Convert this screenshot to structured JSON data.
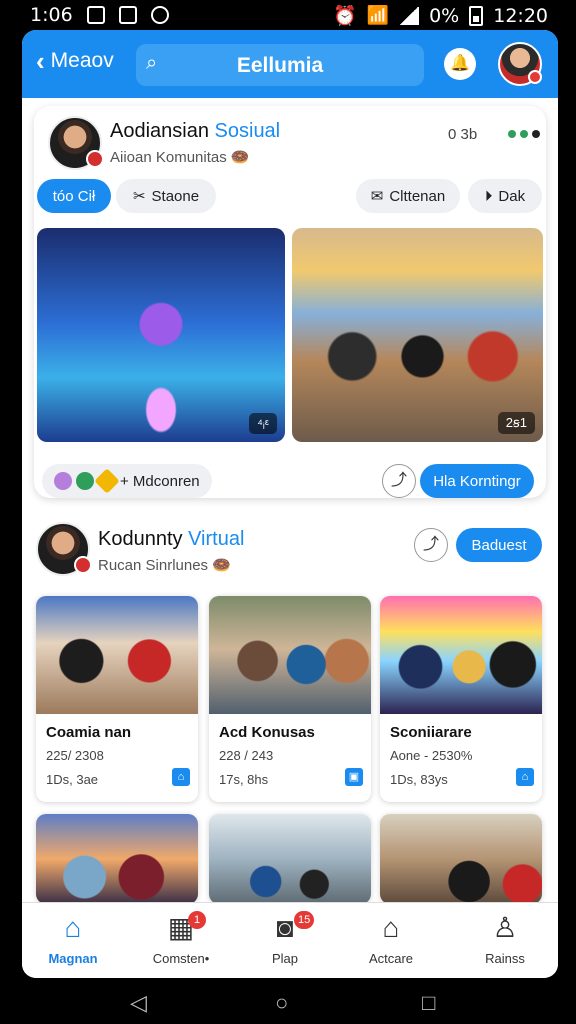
{
  "status_bar": {
    "time_left": "1:06",
    "battery": "0%",
    "time_right": "12:20"
  },
  "header": {
    "back_label": "Meaov",
    "search_title": "Eellumia"
  },
  "post1": {
    "name": "Aodiansian",
    "name_accent": "Sosiual",
    "subtitle": "Aiioan Komunitas",
    "time": "0 3b",
    "chips": [
      "tóo Cił",
      "Staone",
      "Clttenan",
      "Dak"
    ],
    "photo_tags": [
      "⁴ᵢᵋ",
      "2ꞩ1"
    ],
    "reaction_label": "+ Mdconren",
    "primary_button": "Hla Korntingr"
  },
  "post2": {
    "name": "Kodunnty",
    "name_accent": "Virtual",
    "subtitle": "Rucan Sinrlunes",
    "button": "Baduest",
    "tiles": [
      {
        "title": "Coamia nan",
        "line1": "225/ 2308",
        "line2": "1Ds, 3ae"
      },
      {
        "title": "Acd Konusas",
        "line1": "228 / 243",
        "line2": "17s, 8hs"
      },
      {
        "title": "Sconiiarare",
        "line1": "Aone - 2530%",
        "line2": "1Ds, 83ys"
      }
    ]
  },
  "bottom_nav": [
    {
      "label": "Magnan",
      "icon": "home-icon",
      "badge": ""
    },
    {
      "label": "Comsten•",
      "icon": "store-icon",
      "badge": "1"
    },
    {
      "label": "Plap",
      "icon": "media-icon",
      "badge": "15"
    },
    {
      "label": "Actcare",
      "icon": "house-outline-icon",
      "badge": ""
    },
    {
      "label": "Rainss",
      "icon": "person-icon",
      "badge": ""
    }
  ],
  "colors": {
    "accent": "#1a8cf0",
    "badge": "#e53935",
    "active_nav": "#1a7fe0"
  }
}
